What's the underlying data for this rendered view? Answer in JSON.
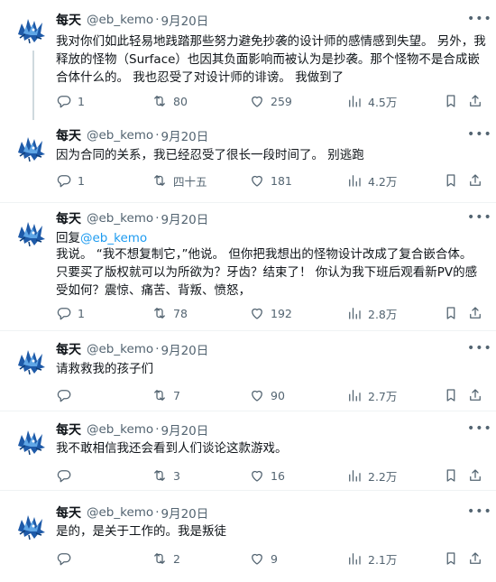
{
  "author": {
    "name": "每天",
    "handle": "@eb_kemo"
  },
  "icons": {
    "reply": "reply-icon",
    "retweet": "retweet-icon",
    "like": "heart-icon",
    "views": "views-icon",
    "bookmark": "bookmark-icon",
    "share": "share-icon",
    "more": "more-icon"
  },
  "colors": {
    "accent": "#1d9bf0",
    "secondary_text": "#536471",
    "border": "#eff3f4",
    "thread_line": "#cfd9de"
  },
  "tweets": [
    {
      "date": "9月20日",
      "dot": "·",
      "text": "我对你们如此轻易地践踏那些努力避免抄袭的设计师的感情感到失望。 另外，我释放的怪物（Surface）也因其负面影响而被认为是抄袭。那个怪物不是合成嵌合体什么的。 我也忍受了对设计师的诽谤。 我做到了",
      "reply_count": "1",
      "retweet_count": "80",
      "like_count": "259",
      "views": "4.5万"
    },
    {
      "date": "9月20日",
      "dot": "·",
      "text": "因为合同的关系，我已经忍受了很长一段时间了。 别逃跑",
      "reply_count": "1",
      "retweet_count": "四十五",
      "like_count": "181",
      "views": "4.2万"
    },
    {
      "date": "9月20日",
      "dot": "·",
      "reply_to_prefix": "回复",
      "reply_to_handle": "@eb_kemo",
      "text": "我说。 “我不想复制它，”他说。 但你把我想出的怪物设计改成了复合嵌合体。 只要买了版权就可以为所欲为？牙齿？结束了！ 你认为我下班后观看新PV的感受如何？震惊、痛苦、背叛、愤怒，",
      "reply_count": "1",
      "retweet_count": "78",
      "like_count": "192",
      "views": "2.8万"
    },
    {
      "date": "9月20日",
      "dot": "·",
      "text": "请救救我的孩子们",
      "reply_count": "",
      "retweet_count": "7",
      "like_count": "90",
      "views": "2.7万"
    },
    {
      "date": "9月20日",
      "dot": "·",
      "text": "我不敢相信我还会看到人们谈论这款游戏。",
      "reply_count": "",
      "retweet_count": "3",
      "like_count": "16",
      "views": "2.2万"
    },
    {
      "date": "9月20日",
      "dot": "·",
      "text": "是的，是关于工作的。我是叛徒",
      "reply_count": "",
      "retweet_count": "2",
      "like_count": "9",
      "views": "2.1万"
    }
  ]
}
